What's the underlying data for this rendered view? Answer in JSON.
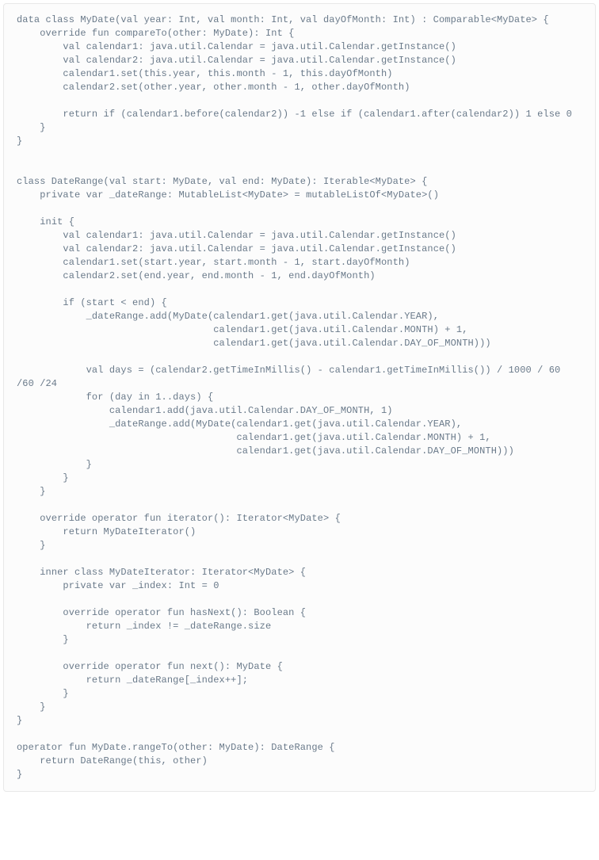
{
  "code": {
    "content": "data class MyDate(val year: Int, val month: Int, val dayOfMonth: Int) : Comparable<MyDate> {\n    override fun compareTo(other: MyDate): Int {\n        val calendar1: java.util.Calendar = java.util.Calendar.getInstance()\n        val calendar2: java.util.Calendar = java.util.Calendar.getInstance()\n        calendar1.set(this.year, this.month - 1, this.dayOfMonth)\n        calendar2.set(other.year, other.month - 1, other.dayOfMonth)\n\n        return if (calendar1.before(calendar2)) -1 else if (calendar1.after(calendar2)) 1 else 0\n    }\n}\n\n\nclass DateRange(val start: MyDate, val end: MyDate): Iterable<MyDate> {\n    private var _dateRange: MutableList<MyDate> = mutableListOf<MyDate>()\n\n    init {\n        val calendar1: java.util.Calendar = java.util.Calendar.getInstance()\n        val calendar2: java.util.Calendar = java.util.Calendar.getInstance()\n        calendar1.set(start.year, start.month - 1, start.dayOfMonth)\n        calendar2.set(end.year, end.month - 1, end.dayOfMonth)\n\n        if (start < end) {\n            _dateRange.add(MyDate(calendar1.get(java.util.Calendar.YEAR),\n                                  calendar1.get(java.util.Calendar.MONTH) + 1,\n                                  calendar1.get(java.util.Calendar.DAY_OF_MONTH)))\n\n            val days = (calendar2.getTimeInMillis() - calendar1.getTimeInMillis()) / 1000 / 60 /60 /24\n            for (day in 1..days) {\n                calendar1.add(java.util.Calendar.DAY_OF_MONTH, 1)\n                _dateRange.add(MyDate(calendar1.get(java.util.Calendar.YEAR),\n                                      calendar1.get(java.util.Calendar.MONTH) + 1,\n                                      calendar1.get(java.util.Calendar.DAY_OF_MONTH)))\n            }\n        }\n    }\n\n    override operator fun iterator(): Iterator<MyDate> {\n        return MyDateIterator()\n    }\n\n    inner class MyDateIterator: Iterator<MyDate> {\n        private var _index: Int = 0\n\n        override operator fun hasNext(): Boolean {\n            return _index != _dateRange.size\n        }\n\n        override operator fun next(): MyDate {\n            return _dateRange[_index++];\n        }\n    }\n}\n\noperator fun MyDate.rangeTo(other: MyDate): DateRange {\n    return DateRange(this, other)\n}"
  },
  "colors": {
    "background": "#fcfcfc",
    "border": "#e8e8e8",
    "text": "#6a7a8a"
  }
}
